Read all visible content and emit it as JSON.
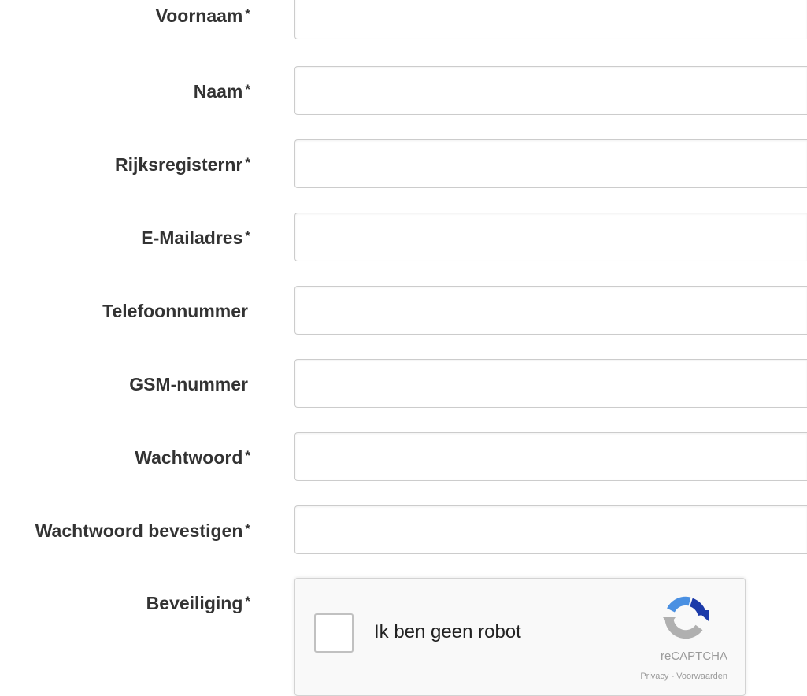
{
  "form": {
    "fields": [
      {
        "label": "Voornaam",
        "required_mark": "*",
        "value": ""
      },
      {
        "label": "Naam",
        "required_mark": "*",
        "value": ""
      },
      {
        "label": "Rijksregisternr",
        "required_mark": "*",
        "value": ""
      },
      {
        "label": "E-Mailadres",
        "required_mark": "*",
        "value": ""
      },
      {
        "label": "Telefoonnummer",
        "required_mark": "",
        "value": ""
      },
      {
        "label": "GSM-nummer",
        "required_mark": "",
        "value": ""
      },
      {
        "label": "Wachtwoord",
        "required_mark": "*",
        "value": ""
      },
      {
        "label": "Wachtwoord bevestigen",
        "required_mark": "*",
        "value": ""
      }
    ],
    "captcha": {
      "label": "Beveiliging",
      "required_mark": "*",
      "checkbox_text": "Ik ben geen robot",
      "brand": "reCAPTCHA",
      "privacy": "Privacy",
      "separator": " - ",
      "terms": "Voorwaarden",
      "icon": "recaptcha-logo-icon",
      "colors": {
        "logo_blue": "#1c3aa9",
        "logo_light_blue": "#4a90e2",
        "logo_gray": "#b0b0b0"
      }
    }
  }
}
